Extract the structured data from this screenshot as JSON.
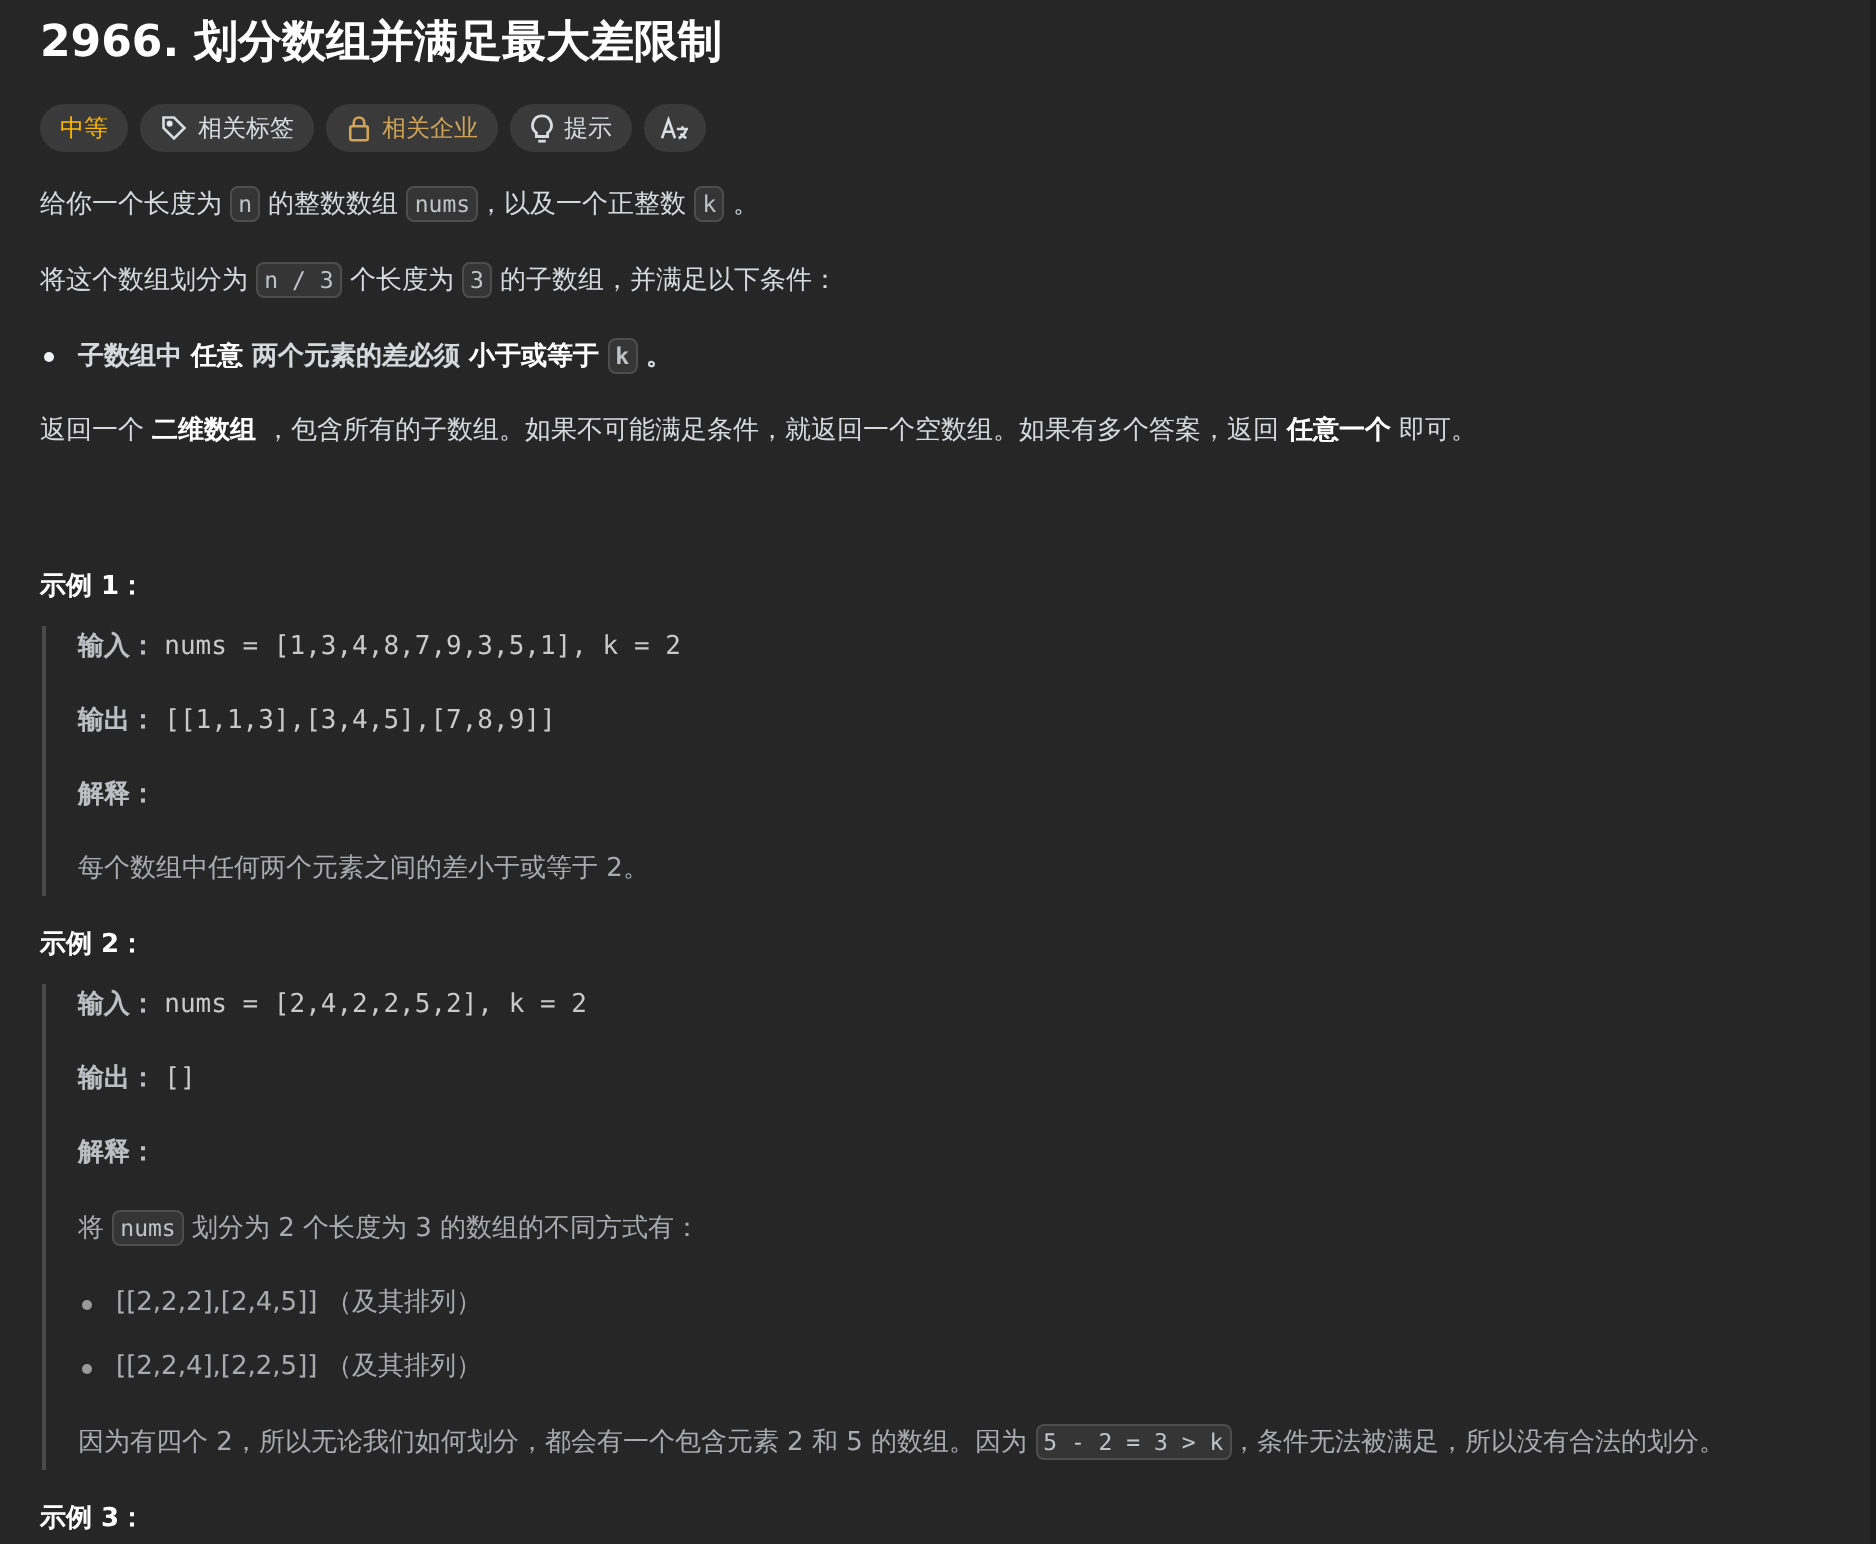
{
  "title": "2966. 划分数组并满足最大差限制",
  "tags": [
    {
      "kind": "difficulty",
      "label": "中等"
    },
    {
      "kind": "tags",
      "label": "相关标签"
    },
    {
      "kind": "companies",
      "label": "相关企业"
    },
    {
      "kind": "hint",
      "label": "提示"
    },
    {
      "kind": "translate"
    }
  ],
  "description": [
    {
      "kind": "paragraph",
      "segments": [
        {
          "kind": "text",
          "text": "给你一个长度为 "
        },
        {
          "kind": "code",
          "text": "n"
        },
        {
          "kind": "text",
          "text": " 的整数数组 "
        },
        {
          "kind": "code",
          "text": "nums"
        },
        {
          "kind": "text",
          "text": "，以及一个正整数 "
        },
        {
          "kind": "code",
          "text": "k"
        },
        {
          "kind": "text",
          "text": " 。"
        }
      ]
    },
    {
      "kind": "paragraph",
      "segments": [
        {
          "kind": "text",
          "text": "将这个数组划分为 "
        },
        {
          "kind": "code",
          "text": "n / 3"
        },
        {
          "kind": "text",
          "text": " 个长度为 "
        },
        {
          "kind": "code",
          "text": "3"
        },
        {
          "kind": "text",
          "text": " 的子数组，并满足以下条件："
        }
      ]
    },
    {
      "kind": "bullet",
      "segments": [
        {
          "kind": "text",
          "text": "子数组中 "
        },
        {
          "kind": "bold",
          "text": "任意"
        },
        {
          "kind": "text",
          "text": " 两个元素的差必须 "
        },
        {
          "kind": "bold",
          "text": "小于或等于"
        },
        {
          "kind": "code",
          "text": "k"
        },
        {
          "kind": "text",
          "text": " 。"
        }
      ]
    },
    {
      "kind": "paragraph",
      "segments": [
        {
          "kind": "text",
          "text": "返回一个 "
        },
        {
          "kind": "bold",
          "text": "二维数组"
        },
        {
          "kind": "text",
          "text": " ，包含所有的子数组。如果不可能满足条件，就返回一个空数组。如果有多个答案，返回 "
        },
        {
          "kind": "bold",
          "text": "任意一个"
        },
        {
          "kind": "text",
          "text": " 即可。"
        }
      ]
    }
  ],
  "examples": [
    {
      "heading": "示例 1：",
      "lines": [
        {
          "kind": "io",
          "label": "输入：",
          "value": "nums = [1,3,4,8,7,9,3,5,1], k = 2"
        },
        {
          "kind": "io",
          "label": "输出：",
          "value": "[[1,1,3],[3,4,5],[7,8,9]]"
        },
        {
          "kind": "label",
          "label": "解释："
        },
        {
          "kind": "text",
          "segments": [
            {
              "kind": "text",
              "text": "每个数组中任何两个元素之间的差小于或等于 2。"
            }
          ]
        }
      ]
    },
    {
      "heading": "示例 2：",
      "lines": [
        {
          "kind": "io",
          "label": "输入：",
          "value": "nums = [2,4,2,2,5,2], k = 2"
        },
        {
          "kind": "io",
          "label": "输出：",
          "value": "[]"
        },
        {
          "kind": "label",
          "label": "解释："
        },
        {
          "kind": "text",
          "segments": [
            {
              "kind": "text",
              "text": "将 "
            },
            {
              "kind": "code",
              "text": "nums"
            },
            {
              "kind": "text",
              "text": " 划分为 2 个长度为 3 的数组的不同方式有："
            }
          ]
        },
        {
          "kind": "list",
          "items": [
            "[[2,2,2],[2,4,5]] （及其排列）",
            "[[2,2,4],[2,2,5]] （及其排列）"
          ]
        },
        {
          "kind": "text",
          "segments": [
            {
              "kind": "text",
              "text": "因为有四个 2，所以无论我们如何划分，都会有一个包含元素 2 和 5 的数组。因为 "
            },
            {
              "kind": "code",
              "text": "5 - 2 = 3 > k"
            },
            {
              "kind": "text",
              "text": "，条件无法被满足，所以没有合法的划分。"
            }
          ]
        }
      ]
    },
    {
      "heading": "示例 3："
    }
  ]
}
